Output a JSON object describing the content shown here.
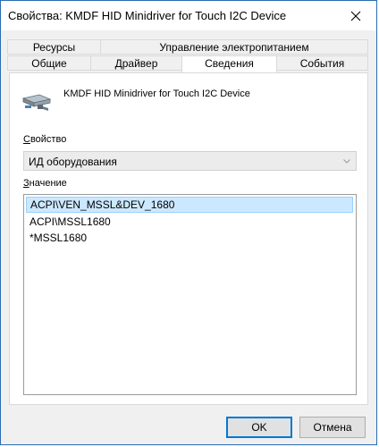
{
  "window": {
    "title": "Свойства: KMDF HID Minidriver for Touch I2C Device"
  },
  "tabs": {
    "row1": [
      {
        "label": "Ресурсы"
      },
      {
        "label": "Управление электропитанием"
      }
    ],
    "row2": [
      {
        "label": "Общие"
      },
      {
        "label": "Драйвер"
      },
      {
        "label": "Сведения",
        "selected": true
      },
      {
        "label": "События"
      }
    ]
  },
  "device": {
    "name": "KMDF HID Minidriver for Touch I2C Device",
    "icon": "hid-device-icon"
  },
  "property": {
    "label": "Свойство",
    "selected_value": "ИД оборудования"
  },
  "value": {
    "label": "Значение",
    "items": [
      "ACPI\\VEN_MSSL&DEV_1680",
      "ACPI\\MSSL1680",
      "*MSSL1680"
    ],
    "selected_index": 0
  },
  "buttons": {
    "ok": "OK",
    "cancel": "Отмена"
  },
  "colors": {
    "accent": "#0078d7",
    "selection_bg": "#cce8ff",
    "selection_border": "#99d1ff"
  }
}
